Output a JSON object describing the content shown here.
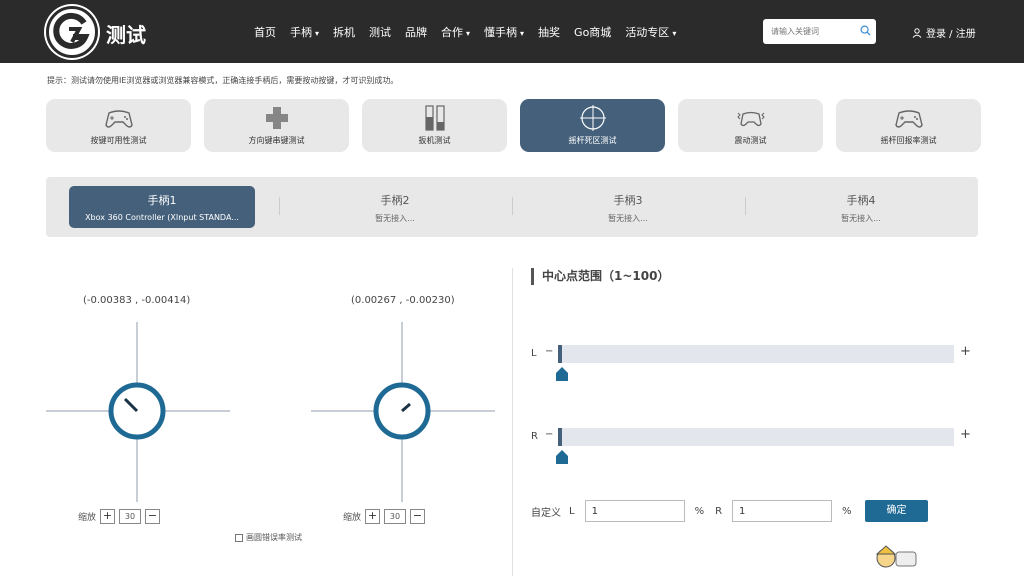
{
  "header": {
    "logo_text": "测试",
    "nav": [
      {
        "label": "首页",
        "caret": false
      },
      {
        "label": "手柄",
        "caret": true
      },
      {
        "label": "拆机",
        "caret": false
      },
      {
        "label": "测试",
        "caret": false
      },
      {
        "label": "品牌",
        "caret": false
      },
      {
        "label": "合作",
        "caret": true
      },
      {
        "label": "懂手柄",
        "caret": true
      },
      {
        "label": "抽奖",
        "caret": false
      },
      {
        "label": "Go商城",
        "caret": false
      },
      {
        "label": "活动专区",
        "caret": true
      }
    ],
    "search_placeholder": "请输入关键词",
    "login": "登录 / 注册"
  },
  "tip": "提示：测试请勿使用IE浏览器或浏览器兼容模式，正确连接手柄后，需要按动按键，才可识别成功。",
  "modes": [
    {
      "label": "按键可用性测试",
      "icon": "gamepad-icon",
      "active": false
    },
    {
      "label": "方向键串键测试",
      "icon": "dpad-icon",
      "active": false
    },
    {
      "label": "扳机测试",
      "icon": "trigger-bars-icon",
      "active": false
    },
    {
      "label": "摇杆死区测试",
      "icon": "crosshair-icon",
      "active": true
    },
    {
      "label": "震动测试",
      "icon": "vibration-gamepad-icon",
      "active": false
    },
    {
      "label": "摇杆回报率测试",
      "icon": "gamepad-icon",
      "active": false
    }
  ],
  "controllers": [
    {
      "title": "手柄1",
      "status": "Xbox 360 Controller (XInput STANDA...",
      "active": true
    },
    {
      "title": "手柄2",
      "status": "暂无接入...",
      "active": false
    },
    {
      "title": "手柄3",
      "status": "暂无接入...",
      "active": false
    },
    {
      "title": "手柄4",
      "status": "暂无接入...",
      "active": false
    }
  ],
  "sticks": {
    "left": {
      "coord": "(-0.00383 , -0.00414)",
      "zoom": "30"
    },
    "right": {
      "coord": "(0.00267 , -0.00230)",
      "zoom": "30"
    },
    "zoom_label": "缩放",
    "circle_test_label": "画圆错误率测试"
  },
  "deadzone": {
    "title": "中心点范围（1~100）",
    "left_label": "L",
    "right_label": "R",
    "left_value": 1,
    "right_value": 1,
    "custom_label": "自定义",
    "custom_left_label": "L",
    "custom_right_label": "R",
    "percent": "%",
    "left_input": "1",
    "right_input": "1",
    "confirm": "确定"
  },
  "colors": {
    "accent": "#44607b",
    "stick_ring": "#1f6a94",
    "header_bg": "#2b2b2b"
  }
}
